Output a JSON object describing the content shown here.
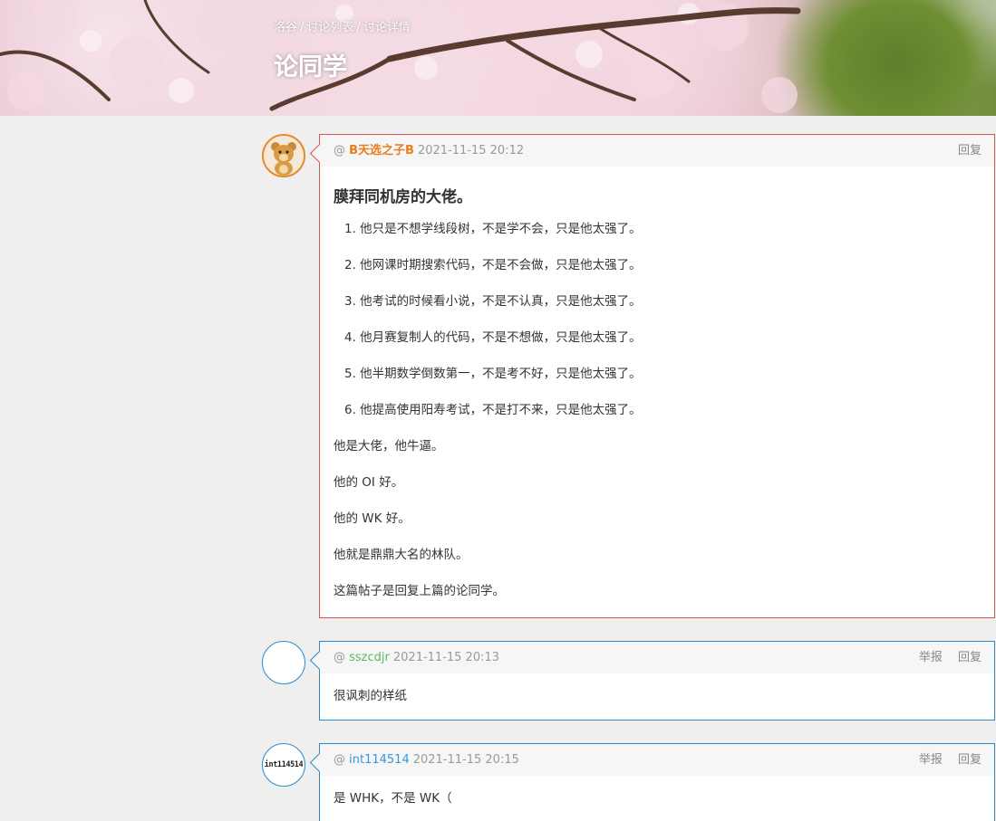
{
  "breadcrumb": [
    "洛谷",
    "讨论列表",
    "讨论详情"
  ],
  "page_title": "论同学",
  "posts": [
    {
      "username": "B天选之子B",
      "time": "2021-11-15 20:12",
      "actions": [
        "回复"
      ],
      "title": "膜拜同机房的大佬。",
      "list": [
        "1. 他只是不想学线段树，不是学不会，只是他太强了。",
        "2. 他网课时期搜索代码，不是不会做，只是他太强了。",
        "3. 他考试的时候看小说，不是不认真，只是他太强了。",
        "4. 他月赛复制人的代码，不是不想做，只是他太强了。",
        "5. 他半期数学倒数第一，不是考不好，只是他太强了。",
        "6. 他提高使用阳寿考试，不是打不来，只是他太强了。"
      ],
      "paragraphs": [
        "他是大佬，他牛逼。",
        "他的 OI 好。",
        "他的 WK 好。",
        "他就是鼎鼎大名的林队。",
        "这篇帖子是回复上篇的论同学。"
      ]
    },
    {
      "username": "sszcdjr",
      "time": "2021-11-15 20:13",
      "actions": [
        "举报",
        "回复"
      ],
      "content": "很讽刺的样纸"
    },
    {
      "username": "int114514",
      "avatar_text": "int114514",
      "time": "2021-11-15 20:15",
      "actions": [
        "举报",
        "回复"
      ],
      "content": "是 WHK，不是 WK（"
    }
  ],
  "colors": {
    "accent_blue": "#2a8ac6",
    "highlight_red": "#d9534f",
    "user_orange": "#e67e22",
    "user_green": "#5eb95e",
    "user_blue": "#3498db"
  }
}
